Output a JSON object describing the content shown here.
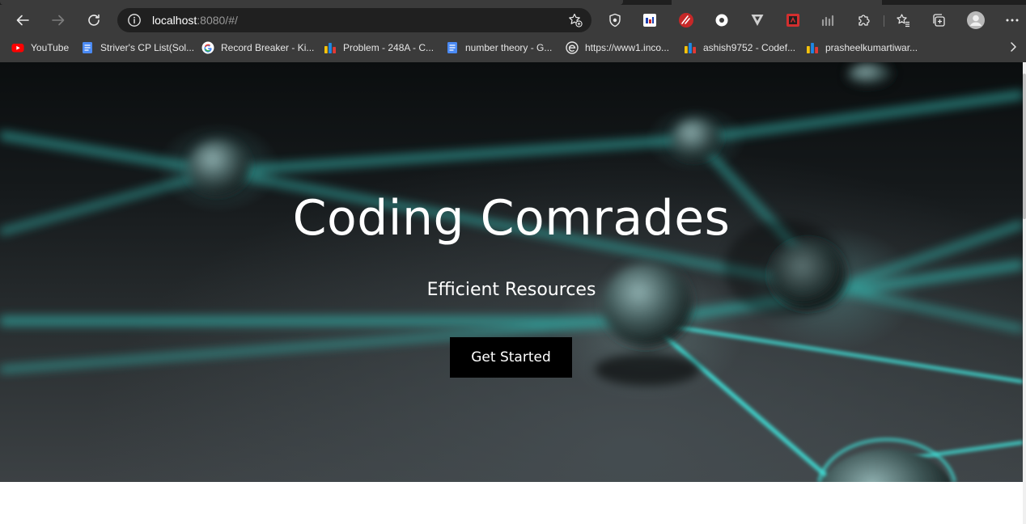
{
  "browser": {
    "address": {
      "host": "localhost",
      "rest": ":8080/#/"
    },
    "bookmarks": [
      {
        "label": "YouTube",
        "icon": "youtube-icon"
      },
      {
        "label": "Striver's CP List(Sol...",
        "icon": "docs-icon"
      },
      {
        "label": "Record Breaker - Ki...",
        "icon": "google-icon"
      },
      {
        "label": "Problem - 248A - C...",
        "icon": "codeforces-icon"
      },
      {
        "label": "number theory - G...",
        "icon": "docs-icon"
      },
      {
        "label": "https://www1.inco...",
        "icon": "edge-page-icon"
      },
      {
        "label": "ashish9752 - Codef...",
        "icon": "codeforces-icon"
      },
      {
        "label": "prasheelkumartiwar...",
        "icon": "codeforces-icon"
      }
    ]
  },
  "hero": {
    "title": "Coding Comrades",
    "subtitle": "Efficient Resources",
    "cta_label": "Get Started"
  },
  "colors": {
    "chrome": "#3b3b3b",
    "omnibox": "#202020",
    "accent_teal": "#3fe0d8",
    "cta_bg": "#000000"
  }
}
